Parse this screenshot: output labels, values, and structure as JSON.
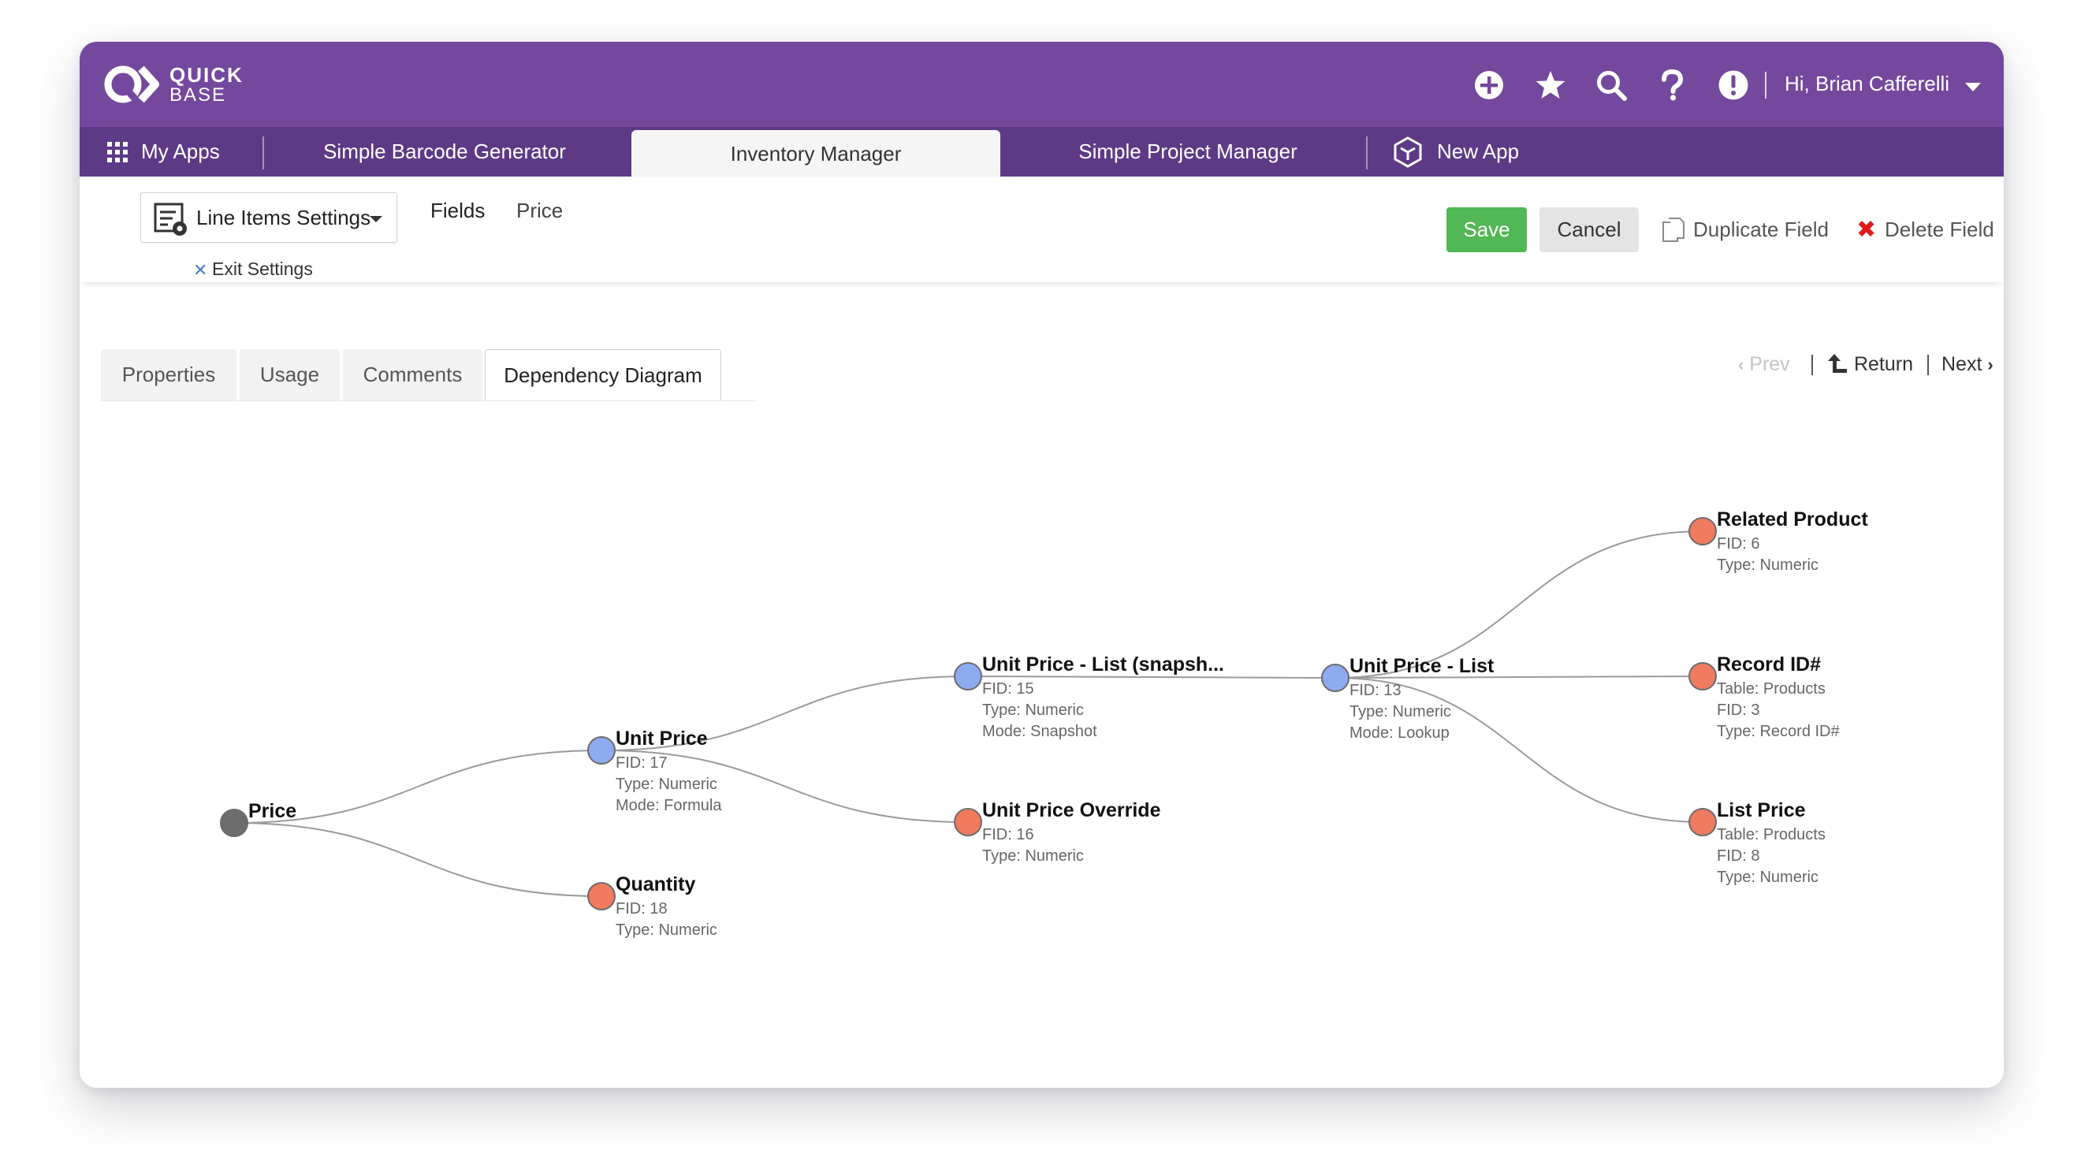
{
  "brand": {
    "line1": "QUICK",
    "line2": "BASE"
  },
  "header": {
    "icons": [
      "plus-circle-icon",
      "star-icon",
      "search-icon",
      "question-icon",
      "alert-icon"
    ],
    "greeting": "Hi, Brian Cafferelli"
  },
  "app_tabs": {
    "my_apps": "My Apps",
    "apps": [
      "Simple Barcode Generator",
      "Inventory Manager",
      "Simple Project Manager"
    ],
    "active": "Inventory Manager",
    "new_app": "New App"
  },
  "settings": {
    "dropdown_label": "Line Items Settings",
    "breadcrumb": [
      "Fields",
      "Price"
    ],
    "exit_label": "Exit Settings",
    "save_label": "Save",
    "cancel_label": "Cancel",
    "duplicate_label": "Duplicate Field",
    "delete_label": "Delete Field"
  },
  "page_tabs": {
    "items": [
      "Properties",
      "Usage",
      "Comments",
      "Dependency Diagram"
    ],
    "active": "Dependency Diagram"
  },
  "record_nav": {
    "prev": "Prev",
    "return": "Return",
    "next": "Next"
  },
  "colors": {
    "header": "#74489d",
    "app_tabs": "#5e3a86",
    "save": "#52b755",
    "node_root": "#6d6d6d",
    "node_formula": "#8eaaf0",
    "node_leaf": "#f07b5f",
    "delete": "#e01b1b"
  },
  "diagram": {
    "nodes": [
      {
        "id": "price",
        "title": "Price",
        "kind": "root",
        "details": []
      },
      {
        "id": "unit_price",
        "title": "Unit Price",
        "kind": "formula",
        "details": [
          "FID: 17",
          "Type: Numeric",
          "Mode: Formula"
        ]
      },
      {
        "id": "quantity",
        "title": "Quantity",
        "kind": "leaf",
        "details": [
          "FID: 18",
          "Type: Numeric"
        ]
      },
      {
        "id": "upl_snapshot",
        "title": "Unit Price - List (snapsh...",
        "kind": "formula",
        "details": [
          "FID: 15",
          "Type: Numeric",
          "Mode: Snapshot"
        ]
      },
      {
        "id": "upo",
        "title": "Unit Price Override",
        "kind": "leaf",
        "details": [
          "FID: 16",
          "Type: Numeric"
        ]
      },
      {
        "id": "upl",
        "title": "Unit Price - List",
        "kind": "formula",
        "details": [
          "FID: 13",
          "Type: Numeric",
          "Mode: Lookup"
        ]
      },
      {
        "id": "related_product",
        "title": "Related Product",
        "kind": "leaf",
        "details": [
          "FID: 6",
          "Type: Numeric"
        ]
      },
      {
        "id": "record_id",
        "title": "Record ID#",
        "kind": "leaf",
        "details": [
          "Table: Products",
          "FID: 3",
          "Type: Record ID#"
        ]
      },
      {
        "id": "list_price",
        "title": "List Price",
        "kind": "leaf",
        "details": [
          "Table: Products",
          "FID: 8",
          "Type: Numeric"
        ]
      }
    ],
    "edges": [
      [
        "price",
        "unit_price"
      ],
      [
        "price",
        "quantity"
      ],
      [
        "unit_price",
        "upl_snapshot"
      ],
      [
        "unit_price",
        "upo"
      ],
      [
        "upl_snapshot",
        "upl"
      ],
      [
        "upl",
        "related_product"
      ],
      [
        "upl",
        "record_id"
      ],
      [
        "upl",
        "list_price"
      ]
    ]
  }
}
